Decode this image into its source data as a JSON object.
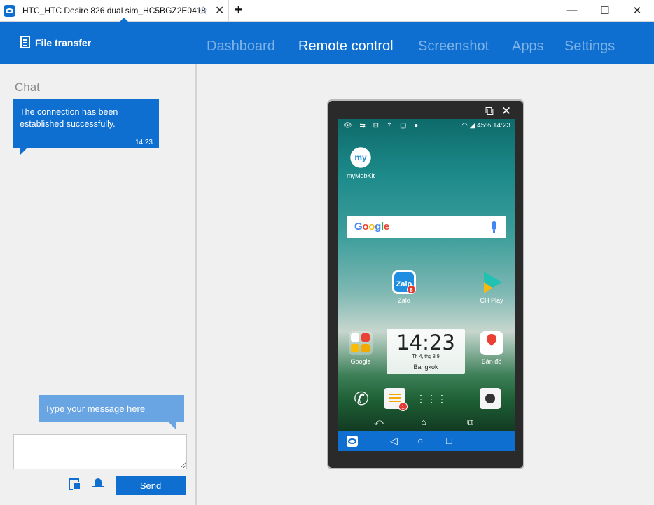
{
  "titlebar": {
    "tab_title": "HTC_HTC Desire 826 dual sim_HC5BGZ2E0418",
    "star_glyph": "☆",
    "close_glyph": "✕",
    "new_tab_glyph": "+",
    "minimize_glyph": "—",
    "maximize_glyph": "☐",
    "window_close_glyph": "✕"
  },
  "header": {
    "file_transfer_label": "File transfer",
    "nav": [
      "Dashboard",
      "Remote control",
      "Screenshot",
      "Apps",
      "Settings"
    ],
    "active_nav": "Remote control",
    "accent_color": "#0e6fd1"
  },
  "chat": {
    "title": "Chat",
    "messages": [
      {
        "text": "The connection has been established successfully.",
        "time": "14:23"
      }
    ],
    "input_hint": "Type your message here",
    "input_value": "",
    "send_label": "Send"
  },
  "phone": {
    "status_time": "14:23",
    "battery": "45%",
    "status_left_glyphs": "👁 ⇆ ⊟ ⇡ ▢ ●",
    "status_right_glyphs": "◠ ◢",
    "popout_glyph": "⧉",
    "close_glyph": "✕",
    "apps": {
      "mymobkit": "myMobKit",
      "mymobkit_icon_text": "my",
      "zalo": "Zalo",
      "zalo_icon_text": "Zalo",
      "zalo_badge": "8",
      "chplay": "CH Play",
      "google_folder": "Google",
      "maps": "Bản đồ"
    },
    "search_logo": "Google",
    "clock": {
      "time": "14:23",
      "date": "Th 4, thg 8 9",
      "city": "Bangkok"
    },
    "dock": {
      "phone_glyph": "✆",
      "messages_badge": "1",
      "apps_glyph": "⋮⋮⋮"
    },
    "android_nav": {
      "back": "⤺",
      "home": "⌂",
      "recents": "⧉"
    },
    "tv_bar": {
      "back": "◁",
      "home": "○",
      "recents": "□"
    }
  }
}
